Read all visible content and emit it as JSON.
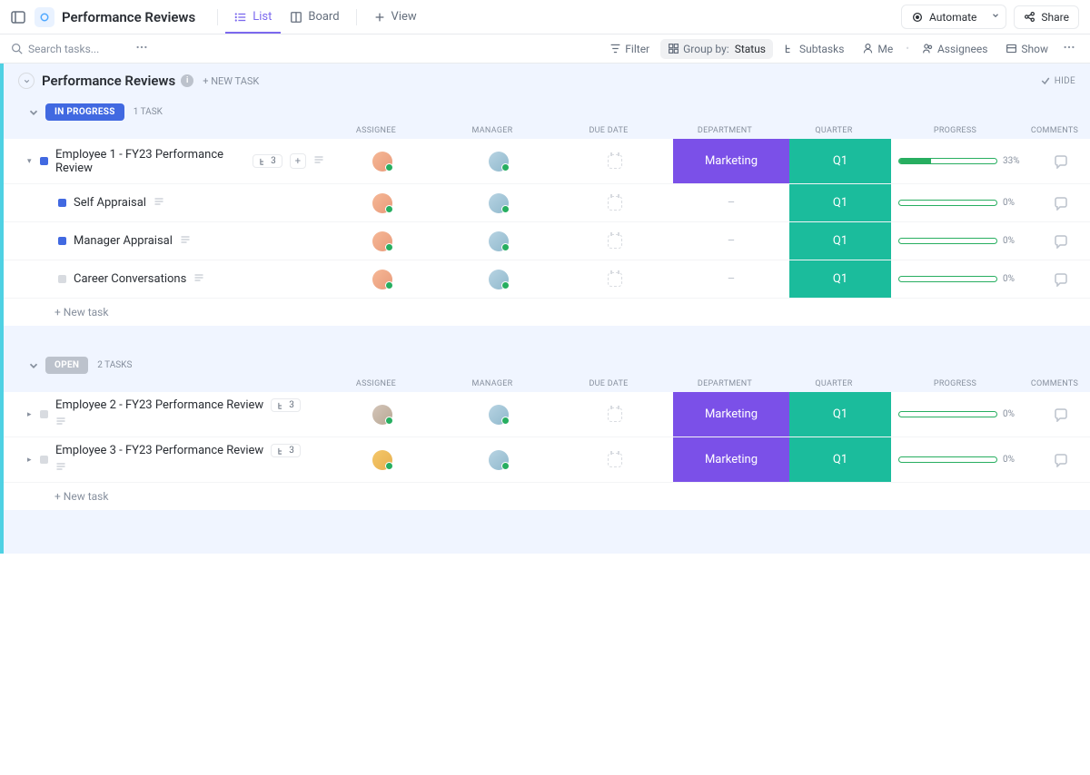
{
  "page_title": "Performance Reviews",
  "tabs": {
    "list": "List",
    "board": "Board",
    "view": "View"
  },
  "top_actions": {
    "automate": "Automate",
    "share": "Share"
  },
  "search": {
    "placeholder": "Search tasks..."
  },
  "toolbar": {
    "filter": "Filter",
    "group_by_label": "Group by:",
    "group_by_value": "Status",
    "subtasks": "Subtasks",
    "me": "Me",
    "assignees": "Assignees",
    "show": "Show"
  },
  "list_header": {
    "title": "Performance Reviews",
    "new_task": "+ NEW TASK",
    "hide": "HIDE"
  },
  "columns": {
    "assignee": "ASSIGNEE",
    "manager": "MANAGER",
    "due_date": "DUE DATE",
    "department": "DEPARTMENT",
    "quarter": "QUARTER",
    "progress": "PROGRESS",
    "comments": "COMMENTS"
  },
  "groups": [
    {
      "status_label": "IN PROGRESS",
      "status_class": "status-in-progress",
      "status_sq": "sq-inprogress",
      "count_label": "1 TASK",
      "tasks": [
        {
          "name": "Employee 1 - FY23 Performance Review",
          "subtask_count": "3",
          "department": "Marketing",
          "dept_class": "dept-purple",
          "quarter": "Q1",
          "progress_pct": 33,
          "progress_label": "33%",
          "expanded": true,
          "subtasks": [
            {
              "name": "Self Appraisal",
              "sq": "sq-inprogress",
              "department": "–",
              "dept_class": "dept-empty",
              "quarter": "Q1",
              "progress_pct": 0,
              "progress_label": "0%"
            },
            {
              "name": "Manager Appraisal",
              "sq": "sq-inprogress",
              "department": "–",
              "dept_class": "dept-empty",
              "quarter": "Q1",
              "progress_pct": 0,
              "progress_label": "0%"
            },
            {
              "name": "Career Conversations",
              "sq": "sq-open",
              "department": "–",
              "dept_class": "dept-empty",
              "quarter": "Q1",
              "progress_pct": 0,
              "progress_label": "0%"
            }
          ]
        }
      ]
    },
    {
      "status_label": "OPEN",
      "status_class": "status-open",
      "status_sq": "sq-open",
      "count_label": "2 TASKS",
      "tasks": [
        {
          "name": "Employee 2 - FY23 Performance Review",
          "subtask_count": "3",
          "department": "Marketing",
          "dept_class": "dept-purple",
          "quarter": "Q1",
          "progress_pct": 0,
          "progress_label": "0%",
          "expanded": false,
          "avatar": "av-3"
        },
        {
          "name": "Employee 3 - FY23 Performance Review",
          "subtask_count": "3",
          "department": "Marketing",
          "dept_class": "dept-purple",
          "quarter": "Q1",
          "progress_pct": 0,
          "progress_label": "0%",
          "expanded": false,
          "avatar": "av-4"
        }
      ]
    }
  ],
  "new_task_row": "+ New task"
}
